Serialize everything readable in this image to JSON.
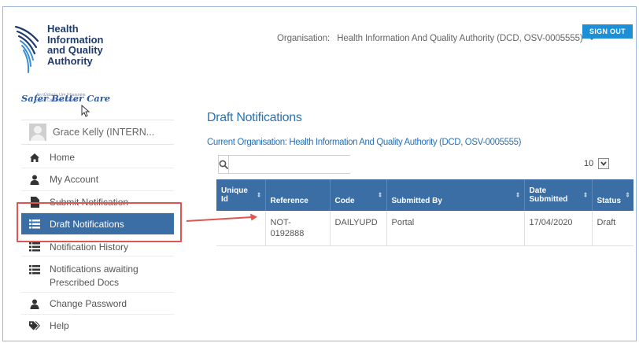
{
  "brand": {
    "name_lines": [
      "Health",
      "Information",
      "and Quality",
      "Authority"
    ],
    "irish_lines": [
      "An tÚdarás Um Fhaisnéis",
      "agus Cáilíocht Sláinte"
    ],
    "tagline": "Safer Better Care"
  },
  "header": {
    "org_label": "Organisation:",
    "org_value": "Health Information And Quality Authority (DCD, OSV-0005555)",
    "signout_label": "SIGN OUT"
  },
  "sidebar": {
    "user_name": "Grace Kelly (INTERN...",
    "items": [
      {
        "label": "Home",
        "icon": "home-icon"
      },
      {
        "label": "My Account",
        "icon": "user-icon"
      },
      {
        "label": "Submit Notification",
        "icon": "file-icon"
      },
      {
        "label": "Draft Notifications",
        "icon": "list-icon"
      },
      {
        "label": "Notification History",
        "icon": "list-icon"
      },
      {
        "label": "Notifications awaiting Prescribed Docs",
        "icon": "list-icon"
      },
      {
        "label": "Change Password",
        "icon": "user-icon"
      },
      {
        "label": "Help",
        "icon": "tags-icon"
      }
    ]
  },
  "main": {
    "title": "Draft Notifications",
    "current_org": "Current Organisation: Health Information And Quality Authority (DCD, OSV-0005555)",
    "search_value": "",
    "page_size": "10",
    "columns": [
      "Unique Id",
      "Reference",
      "Code",
      "Submitted By",
      "Date Submitted",
      "Status"
    ],
    "rows": [
      {
        "unique_id": "",
        "reference": "NOT-0192888",
        "reference_lines": [
          "NOT-",
          "0192888"
        ],
        "code": "DAILYUPD",
        "submitted_by": "Portal",
        "date_submitted": "17/04/2020",
        "status": "Draft"
      }
    ]
  },
  "colors": {
    "accent": "#3a6ea5",
    "link": "#2a72b5",
    "signout": "#1d8fd6",
    "annotation": "#e0554f"
  }
}
